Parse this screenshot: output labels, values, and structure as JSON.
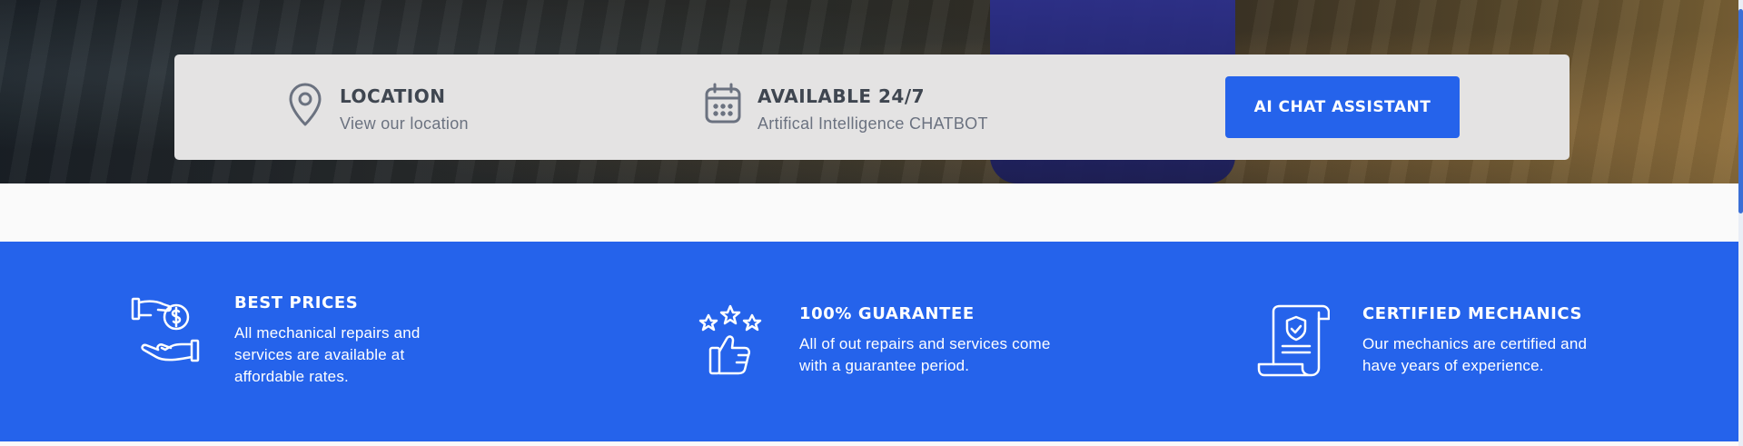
{
  "info_bar": {
    "location": {
      "title": "LOCATION",
      "subtitle": "View our location",
      "icon": "map-pin-icon"
    },
    "availability": {
      "title": "AVAILABLE 24/7",
      "subtitle": "Artifical Intelligence CHATBOT",
      "icon": "calendar-icon"
    },
    "cta_label": "AI CHAT ASSISTANT"
  },
  "features": [
    {
      "title": "BEST PRICES",
      "text": "All mechanical repairs and services are available at affordable rates.",
      "icon": "hand-money-icon"
    },
    {
      "title": "100% GUARANTEE",
      "text": "All of out repairs and services come with a guarantee period.",
      "icon": "thumbs-up-stars-icon"
    },
    {
      "title": "CERTIFIED MECHANICS",
      "text": "Our mechanics are certified and have years of experience.",
      "icon": "certificate-scroll-icon"
    }
  ],
  "colors": {
    "accent": "#2563eb",
    "bar_bg": "#e4e3e3",
    "text_dark": "#3f4650",
    "text_muted": "#6b7280"
  }
}
